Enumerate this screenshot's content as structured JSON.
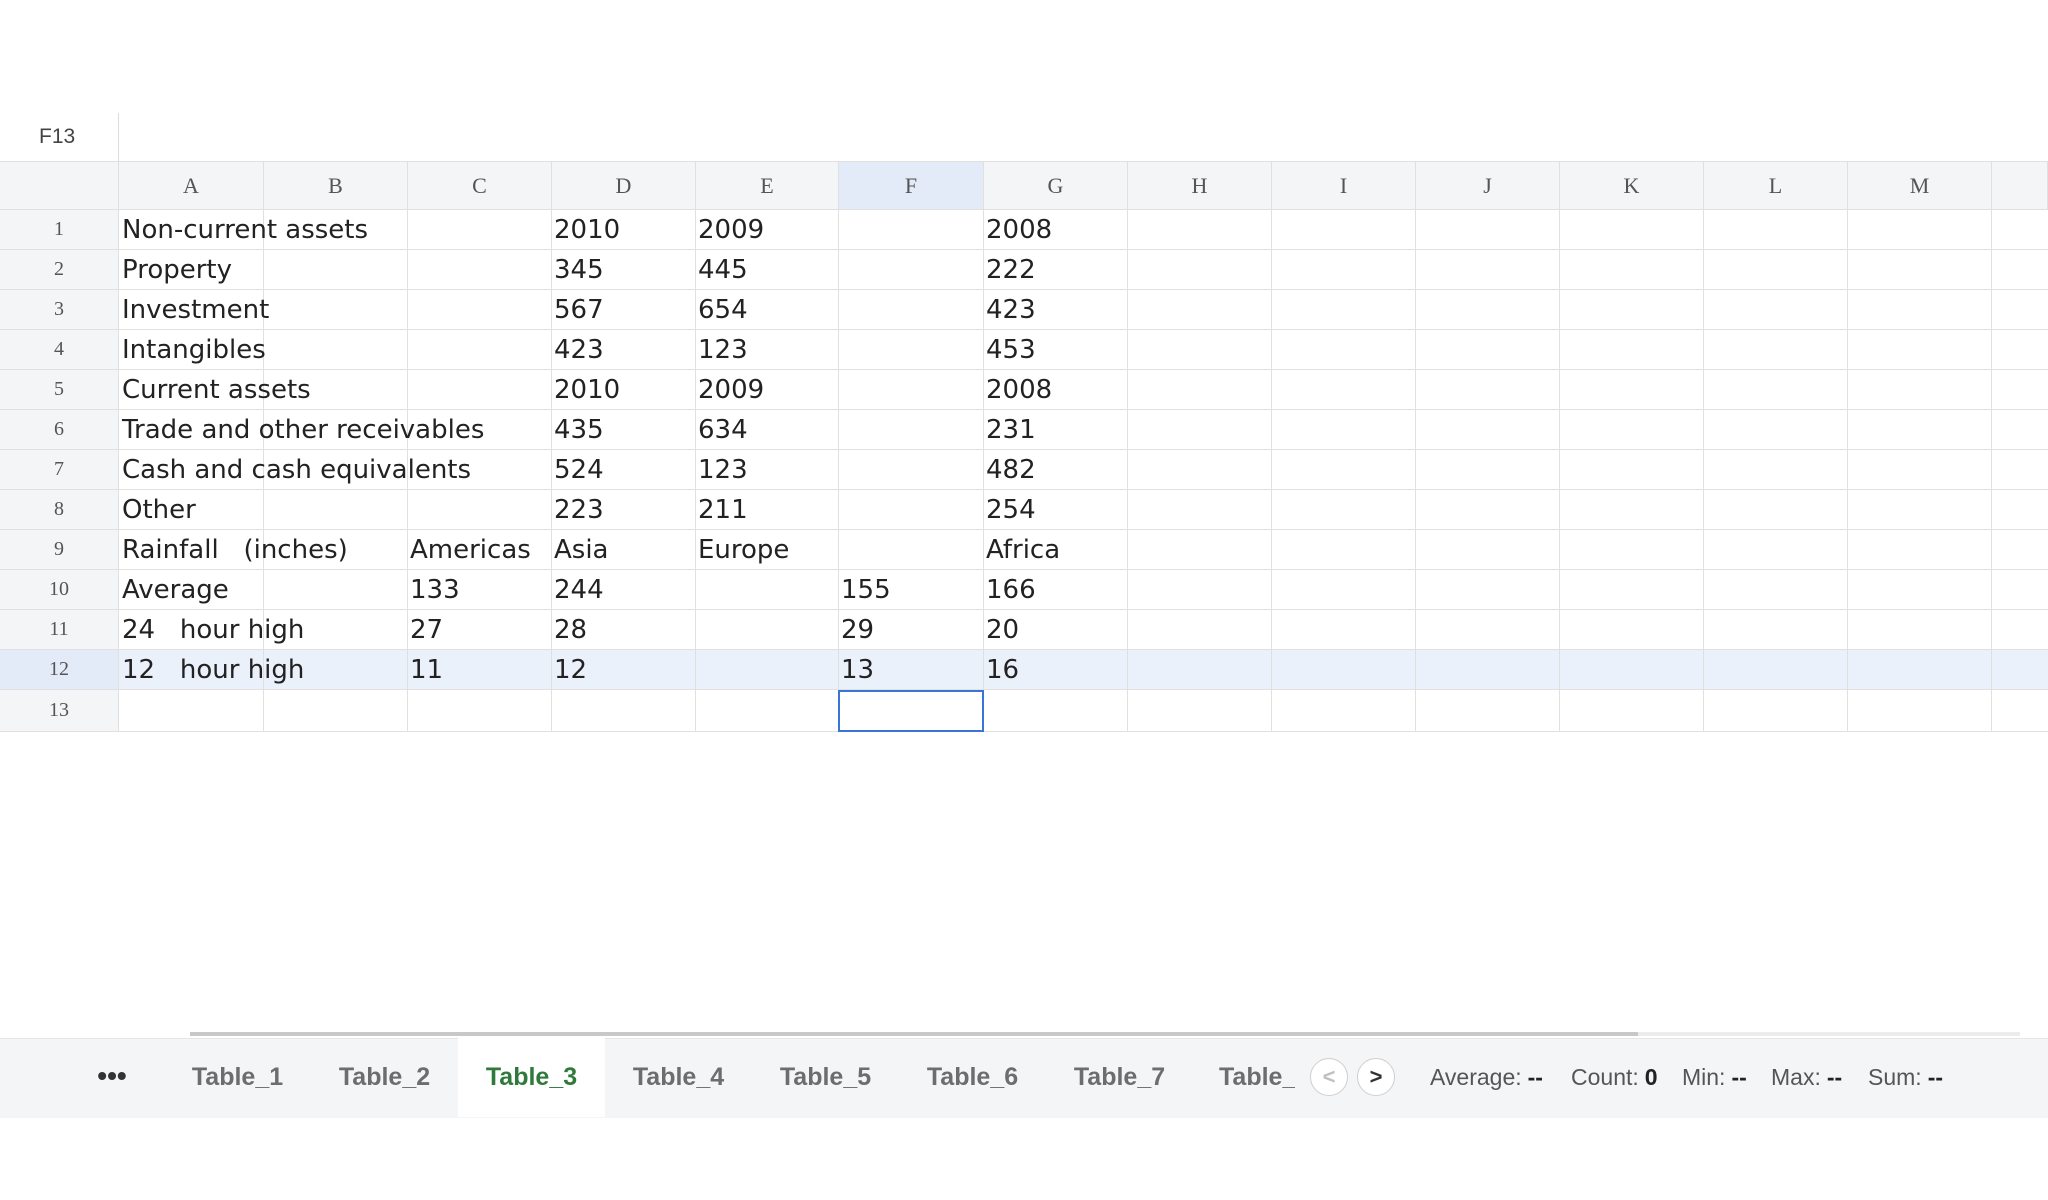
{
  "namebox": "F13",
  "formula": "",
  "columns": [
    "A",
    "B",
    "C",
    "D",
    "E",
    "F",
    "G",
    "H",
    "I",
    "J",
    "K",
    "L",
    "M"
  ],
  "active_column": "F",
  "rows": [
    "1",
    "2",
    "3",
    "4",
    "5",
    "6",
    "7",
    "8",
    "9",
    "10",
    "11",
    "12",
    "13"
  ],
  "active_row": "12",
  "selected_cell": "F13",
  "cells": {
    "r1": {
      "a": "Non-current assets",
      "d": "2010",
      "e": "2009",
      "g": "2008"
    },
    "r2": {
      "a": "Property",
      "d": "345",
      "e": "445",
      "g": "222"
    },
    "r3": {
      "a": "Investment",
      "d": "567",
      "e": "654",
      "g": "423"
    },
    "r4": {
      "a": "Intangibles",
      "d": "423",
      "e": "123",
      "g": "453"
    },
    "r5": {
      "a": "Current assets",
      "d": "2010",
      "e": "2009",
      "g": "2008"
    },
    "r6": {
      "a": "Trade and other receivables",
      "d": "435",
      "e": "634",
      "g": "231"
    },
    "r7": {
      "a": "Cash and cash equivalents",
      "d": "524",
      "e": "123",
      "g": "482"
    },
    "r8": {
      "a": "Other",
      "d": "223",
      "e": "211",
      "g": "254"
    },
    "r9": {
      "a": "Rainfall   (inches)",
      "c": "Americas",
      "d": "Asia",
      "e": "Europe",
      "g": "Africa"
    },
    "r10": {
      "a": "Average",
      "c": "133",
      "d": "244",
      "f": "155",
      "g": "166"
    },
    "r11": {
      "a": "24   hour high",
      "c": "27",
      "d": "28",
      "f": "29",
      "g": "20"
    },
    "r12": {
      "a": "12   hour high",
      "c": "11",
      "d": "12",
      "f": "13",
      "g": "16"
    }
  },
  "sheet_tabs": [
    "Table_1",
    "Table_2",
    "Table_3",
    "Table_4",
    "Table_5",
    "Table_6",
    "Table_7",
    "Table_"
  ],
  "active_tab": "Table_3",
  "more_label": "•••",
  "nav": {
    "prev": "<",
    "next": ">"
  },
  "stats": {
    "average_label": "Average:",
    "average_value": "--",
    "count_label": "Count:",
    "count_value": "0",
    "min_label": "Min:",
    "min_value": "--",
    "max_label": "Max:",
    "max_value": "--",
    "sum_label": "Sum:",
    "sum_value": "--"
  },
  "colors": {
    "active_tab": "#2f7a3a",
    "selection": "#3a74d6",
    "active_header": "#e3ebf8"
  }
}
